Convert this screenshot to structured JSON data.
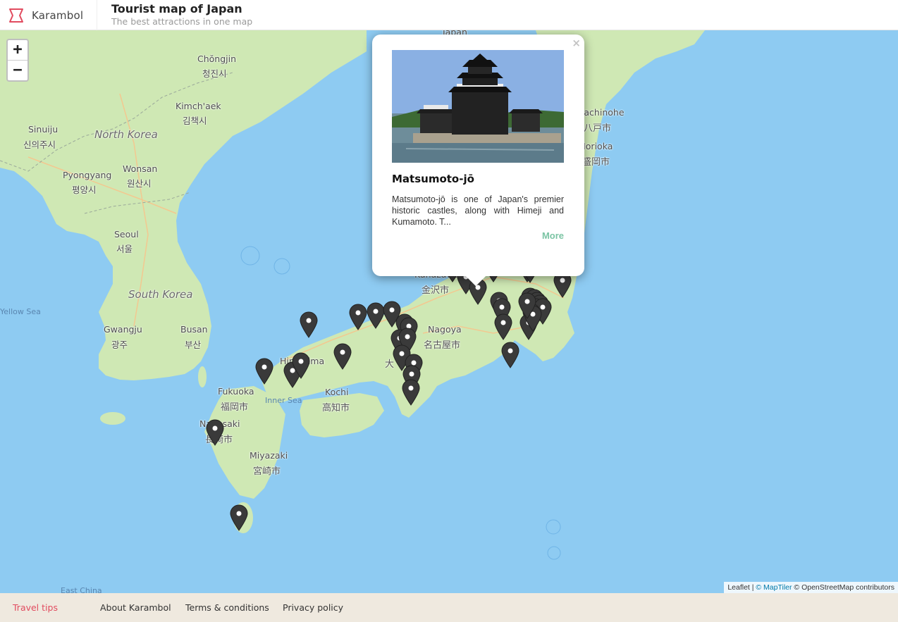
{
  "header": {
    "brand": "Karambol",
    "title": "Tourist map of Japan",
    "subtitle": "The best attractions in one map"
  },
  "map": {
    "zoom_in": "+",
    "zoom_out": "−",
    "places": {
      "chongjin": "Chŏngjin",
      "chongjin_kr": "청진시",
      "kimchaek": "Kimch'aek",
      "kimchaek_kr": "김책시",
      "north_korea": "North Korea",
      "sinuiju": "Sinuiju",
      "sinuiju_kr": "신의주시",
      "pyongyang": "Pyongyang",
      "pyongyang_kr": "평양시",
      "wonsan": "Wonsan",
      "wonsan_kr": "원산시",
      "seoul": "Seoul",
      "seoul_kr": "서울",
      "south_korea": "South Korea",
      "gwangju": "Gwangju",
      "gwangju_kr": "광주",
      "busan": "Busan",
      "busan_kr": "부산",
      "yellow_sea": "Yellow Sea",
      "fukuoka": "Fukuoka",
      "fukuoka_jp": "福岡市",
      "nagasaki": "Nagasaki",
      "nagasaki_jp": "長崎市",
      "miyazaki": "Miyazaki",
      "miyazaki_jp": "宮崎市",
      "hiroshima": "Hiroshima",
      "inner_sea": "Inner Sea",
      "kochi": "Kochi",
      "kochi_jp": "高知市",
      "nagoya": "Nagoya",
      "nagoya_jp": "名古屋市",
      "kanazawa": "Kanazawa",
      "kanazawa_jp": "金沢市",
      "hachinohe": "Hachinohe",
      "hachinohe_jp": "八戸市",
      "morioka": "Morioka",
      "morioka_jp": "盛岡市",
      "osaka_jp": "大",
      "japan": "Japan",
      "east_china": "East China"
    },
    "pin_color": "#3a3a3a",
    "pin_count": 46
  },
  "popup": {
    "close": "×",
    "title": "Matsumoto-jō",
    "description": "Matsumoto-jō is one of Japan's premier historic castles, along with Himeji and Kumamoto. T...",
    "more": "More",
    "image_alt": "Matsumoto castle"
  },
  "attribution": {
    "leaflet": "Leaflet",
    "sep": " | ",
    "maptiler": "© MapTiler",
    "osm": " © OpenStreetMap contributors"
  },
  "footer": {
    "tips": "Travel tips",
    "about": "About Karambol",
    "terms": "Terms & conditions",
    "privacy": "Privacy policy"
  },
  "colors": {
    "water": "#8ecbf2",
    "land": "#cfe8b4",
    "brand": "#e14b5f",
    "more": "#7bc4a4"
  }
}
